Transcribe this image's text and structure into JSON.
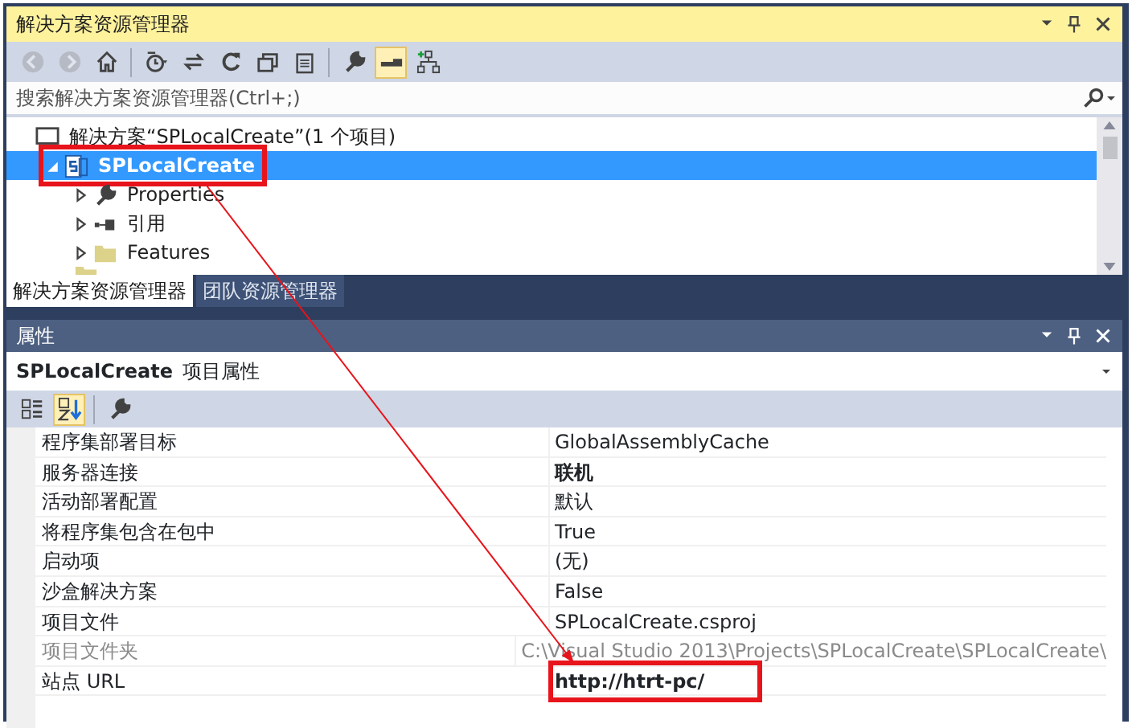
{
  "solution_explorer": {
    "title": "解决方案资源管理器",
    "toolbar": [
      {
        "disabled": true,
        "selected": false
      },
      {
        "disabled": true,
        "selected": false
      },
      {
        "disabled": false,
        "selected": false
      },
      {
        "disabled": false,
        "selected": false
      },
      {
        "disabled": false,
        "selected": false
      },
      {
        "disabled": false,
        "selected": false
      },
      {
        "disabled": false,
        "selected": false
      },
      {
        "disabled": false,
        "selected": false
      },
      {
        "disabled": false,
        "selected": false
      },
      {
        "disabled": false,
        "selected": true
      },
      {
        "disabled": false,
        "selected": false
      }
    ],
    "search": {
      "placeholder": "搜索解决方案资源管理器(Ctrl+;)"
    },
    "tree": [
      {
        "label": "解决方案“SPLocalCreate”(1 个项目)",
        "kind": "solution",
        "selected": false,
        "highlighted": false,
        "children": [
          {
            "label": "SPLocalCreate",
            "kind": "project",
            "selected": true,
            "highlighted": true,
            "expanded": true,
            "children": [
              {
                "label": "Properties",
                "kind": "properties",
                "selected": false,
                "highlighted": false,
                "expanded": false
              },
              {
                "label": "引用",
                "kind": "references",
                "selected": false,
                "highlighted": false,
                "expanded": false
              },
              {
                "label": "Features",
                "kind": "folder",
                "selected": false,
                "highlighted": false,
                "expanded": false
              }
            ]
          }
        ]
      }
    ],
    "tabs": [
      {
        "label": "解决方案资源管理器",
        "selected": true
      },
      {
        "label": "团队资源管理器",
        "selected": false
      }
    ]
  },
  "properties": {
    "title": "属性",
    "object": {
      "name": "SPLocalCreate",
      "type": "项目属性"
    },
    "toolbar": [
      {
        "selected": false
      },
      {
        "selected": true
      },
      {
        "selected": false
      }
    ],
    "rows": [
      {
        "name": "程序集部署目标",
        "value": "GlobalAssemblyCache",
        "bold": false,
        "disabled": false,
        "highlighted": false
      },
      {
        "name": "服务器连接",
        "value": "联机",
        "bold": true,
        "disabled": false,
        "highlighted": false
      },
      {
        "name": "活动部署配置",
        "value": "默认",
        "bold": false,
        "disabled": false,
        "highlighted": false
      },
      {
        "name": "将程序集包含在包中",
        "value": "True",
        "bold": false,
        "disabled": false,
        "highlighted": false
      },
      {
        "name": "启动项",
        "value": "(无)",
        "bold": false,
        "disabled": false,
        "highlighted": false
      },
      {
        "name": "沙盒解决方案",
        "value": "False",
        "bold": false,
        "disabled": false,
        "highlighted": false
      },
      {
        "name": "项目文件",
        "value": "SPLocalCreate.csproj",
        "bold": false,
        "disabled": false,
        "highlighted": false
      },
      {
        "name": "项目文件夹",
        "value": "C:\\Visual Studio 2013\\Projects\\SPLocalCreate\\SPLocalCreate\\",
        "bold": false,
        "disabled": true,
        "highlighted": false
      },
      {
        "name": "站点 URL",
        "value": "http://htrt-pc/",
        "bold": true,
        "disabled": false,
        "highlighted": true
      }
    ]
  },
  "annotation": {
    "kind": "arrow"
  }
}
